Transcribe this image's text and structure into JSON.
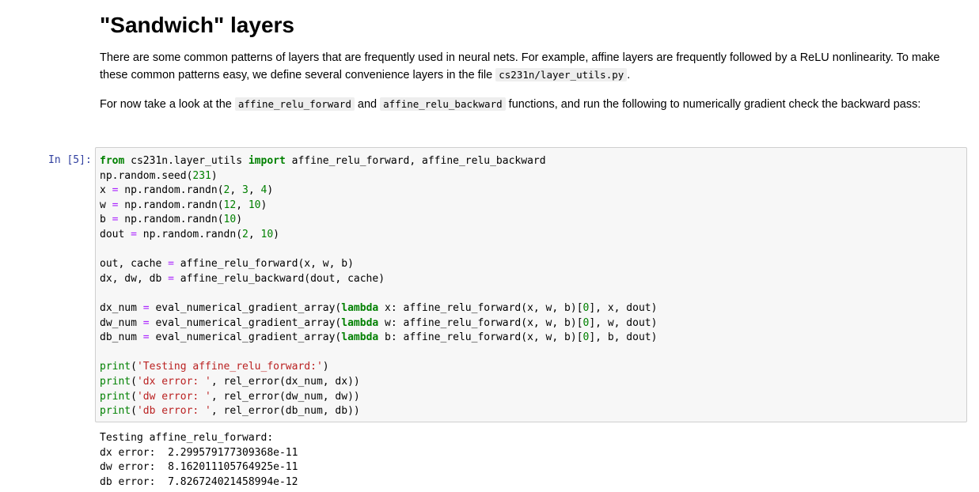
{
  "markdown": {
    "title": "\"Sandwich\" layers",
    "p1_text": "There are some common patterns of layers that are frequently used in neural nets. For example, affine layers are frequently followed by a ReLU nonlinearity. To make these common patterns easy, we define several convenience layers in the file ",
    "p1_code": "cs231n/layer_utils.py",
    "p1_end": ".",
    "p2_start": "For now take a look at the ",
    "p2_code1": "affine_relu_forward",
    "p2_mid": " and ",
    "p2_code2": "affine_relu_backward",
    "p2_end": " functions, and run the following to numerically gradient check the backward pass:"
  },
  "cell": {
    "prompt": "In [5]:",
    "code_lines": [
      "from cs231n.layer_utils import affine_relu_forward, affine_relu_backward",
      "np.random.seed(231)",
      "x = np.random.randn(2, 3, 4)",
      "w = np.random.randn(12, 10)",
      "b = np.random.randn(10)",
      "dout = np.random.randn(2, 10)",
      "",
      "out, cache = affine_relu_forward(x, w, b)",
      "dx, dw, db = affine_relu_backward(dout, cache)",
      "",
      "dx_num = eval_numerical_gradient_array(lambda x: affine_relu_forward(x, w, b)[0], x, dout)",
      "dw_num = eval_numerical_gradient_array(lambda w: affine_relu_forward(x, w, b)[0], w, dout)",
      "db_num = eval_numerical_gradient_array(lambda b: affine_relu_forward(x, w, b)[0], b, dout)",
      "",
      "print('Testing affine_relu_forward:')",
      "print('dx error: ', rel_error(dx_num, dx))",
      "print('dw error: ', rel_error(dw_num, dw))",
      "print('db error: ', rel_error(db_num, db))"
    ],
    "output_lines": [
      "Testing affine_relu_forward:",
      "dx error:  2.299579177309368e-11",
      "dw error:  8.162011105764925e-11",
      "db error:  7.826724021458994e-12"
    ]
  },
  "colors": {
    "keyword": "#008000",
    "string": "#ba2121",
    "operator": "#aa22ff",
    "prompt": "#303f9f"
  }
}
